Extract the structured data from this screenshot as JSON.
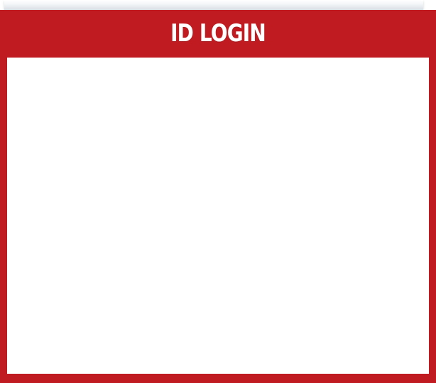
{
  "login_panel": {
    "title": "ID LOGIN"
  },
  "colors": {
    "accent": "#bf1b21",
    "body_background": "#ffffff",
    "title_text": "#ffffff"
  }
}
